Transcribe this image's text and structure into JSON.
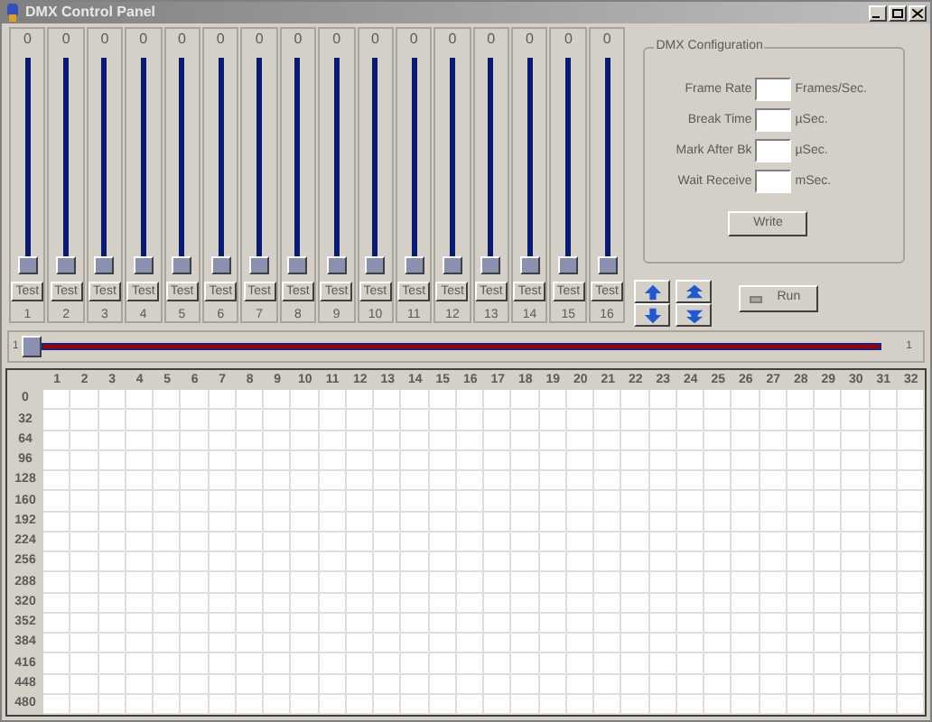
{
  "window": {
    "title": "DMX Control Panel"
  },
  "channels": [
    {
      "value": "0",
      "level": 0,
      "test": "Test",
      "number": "1"
    },
    {
      "value": "0",
      "level": 0,
      "test": "Test",
      "number": "2"
    },
    {
      "value": "0",
      "level": 0,
      "test": "Test",
      "number": "3"
    },
    {
      "value": "0",
      "level": 0,
      "test": "Test",
      "number": "4"
    },
    {
      "value": "0",
      "level": 0,
      "test": "Test",
      "number": "5"
    },
    {
      "value": "0",
      "level": 0,
      "test": "Test",
      "number": "6"
    },
    {
      "value": "0",
      "level": 0,
      "test": "Test",
      "number": "7"
    },
    {
      "value": "0",
      "level": 0,
      "test": "Test",
      "number": "8"
    },
    {
      "value": "0",
      "level": 0,
      "test": "Test",
      "number": "9"
    },
    {
      "value": "0",
      "level": 0,
      "test": "Test",
      "number": "10"
    },
    {
      "value": "0",
      "level": 0,
      "test": "Test",
      "number": "11"
    },
    {
      "value": "0",
      "level": 0,
      "test": "Test",
      "number": "12"
    },
    {
      "value": "0",
      "level": 0,
      "test": "Test",
      "number": "13"
    },
    {
      "value": "0",
      "level": 0,
      "test": "Test",
      "number": "14"
    },
    {
      "value": "0",
      "level": 0,
      "test": "Test",
      "number": "15"
    },
    {
      "value": "0",
      "level": 0,
      "test": "Test",
      "number": "16"
    }
  ],
  "config": {
    "title": "DMX Configuration",
    "fields": [
      {
        "label": "Frame Rate",
        "unit": "Frames/Sec."
      },
      {
        "label": "Break Time",
        "unit": "µSec."
      },
      {
        "label": "Mark After Bk",
        "unit": "µSec."
      },
      {
        "label": "Wait Receive",
        "unit": "mSec."
      }
    ],
    "write": "Write"
  },
  "run": {
    "label": "Run",
    "on": false
  },
  "bank_slider": {
    "min_label": "1",
    "level": 0,
    "reading": "1"
  },
  "grid": {
    "columns": [
      "1",
      "2",
      "3",
      "4",
      "5",
      "6",
      "7",
      "8",
      "9",
      "10",
      "11",
      "12",
      "13",
      "14",
      "15",
      "16",
      "17",
      "18",
      "19",
      "20",
      "21",
      "22",
      "23",
      "24",
      "25",
      "26",
      "27",
      "28",
      "29",
      "30",
      "31",
      "32"
    ],
    "rows": [
      "0",
      "32",
      "64",
      "96",
      "128",
      "160",
      "192",
      "224",
      "256",
      "288",
      "320",
      "352",
      "384",
      "416",
      "448",
      "480"
    ]
  }
}
